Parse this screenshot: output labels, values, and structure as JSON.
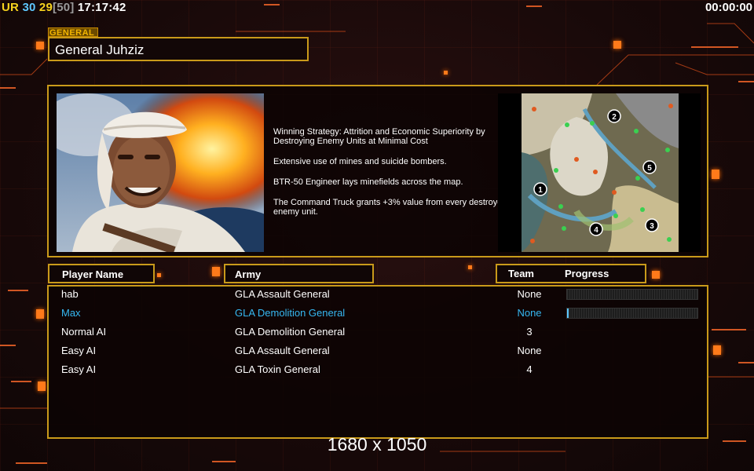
{
  "stats": {
    "ur": "UR",
    "val1": "30",
    "val2": "29",
    "val3": "[50]",
    "clock": "17:17:42"
  },
  "timer": "00:00:00",
  "general": {
    "tag": "GENERAL",
    "name": "General Juhziz",
    "description": [
      "Winning Strategy: Attrition and Economic Superiority by Destroying Enemy Units at Minimal Cost",
      "Extensive use of mines and suicide bombers.",
      "BTR-50 Engineer lays minefields across the map.",
      "The Command Truck grants +3% value from every destroyed enemy unit."
    ]
  },
  "minimap": {
    "start_positions": [
      "1",
      "2",
      "3",
      "4",
      "5"
    ]
  },
  "table": {
    "headers": {
      "player": "Player Name",
      "army": "Army",
      "team": "Team",
      "progress": "Progress"
    },
    "rows": [
      {
        "name": "hab",
        "army": "GLA Assault General",
        "team": "None",
        "progress": 0,
        "show_bar": true,
        "highlight": false
      },
      {
        "name": "Max",
        "army": "GLA Demolition General",
        "team": "None",
        "progress": 0.01,
        "show_bar": true,
        "highlight": true
      },
      {
        "name": "Normal AI",
        "army": "GLA Demolition General",
        "team": "3",
        "progress": null,
        "show_bar": false,
        "highlight": false
      },
      {
        "name": "Easy AI",
        "army": "GLA Assault General",
        "team": "None",
        "progress": null,
        "show_bar": false,
        "highlight": false
      },
      {
        "name": "Easy AI",
        "army": "GLA Toxin General",
        "team": "4",
        "progress": null,
        "show_bar": false,
        "highlight": false
      }
    ]
  },
  "resolution": "1680 x 1050",
  "colors": {
    "frame": "#c99a1a",
    "highlight": "#36b8f2",
    "accent_orange": "#ff7a1a"
  }
}
